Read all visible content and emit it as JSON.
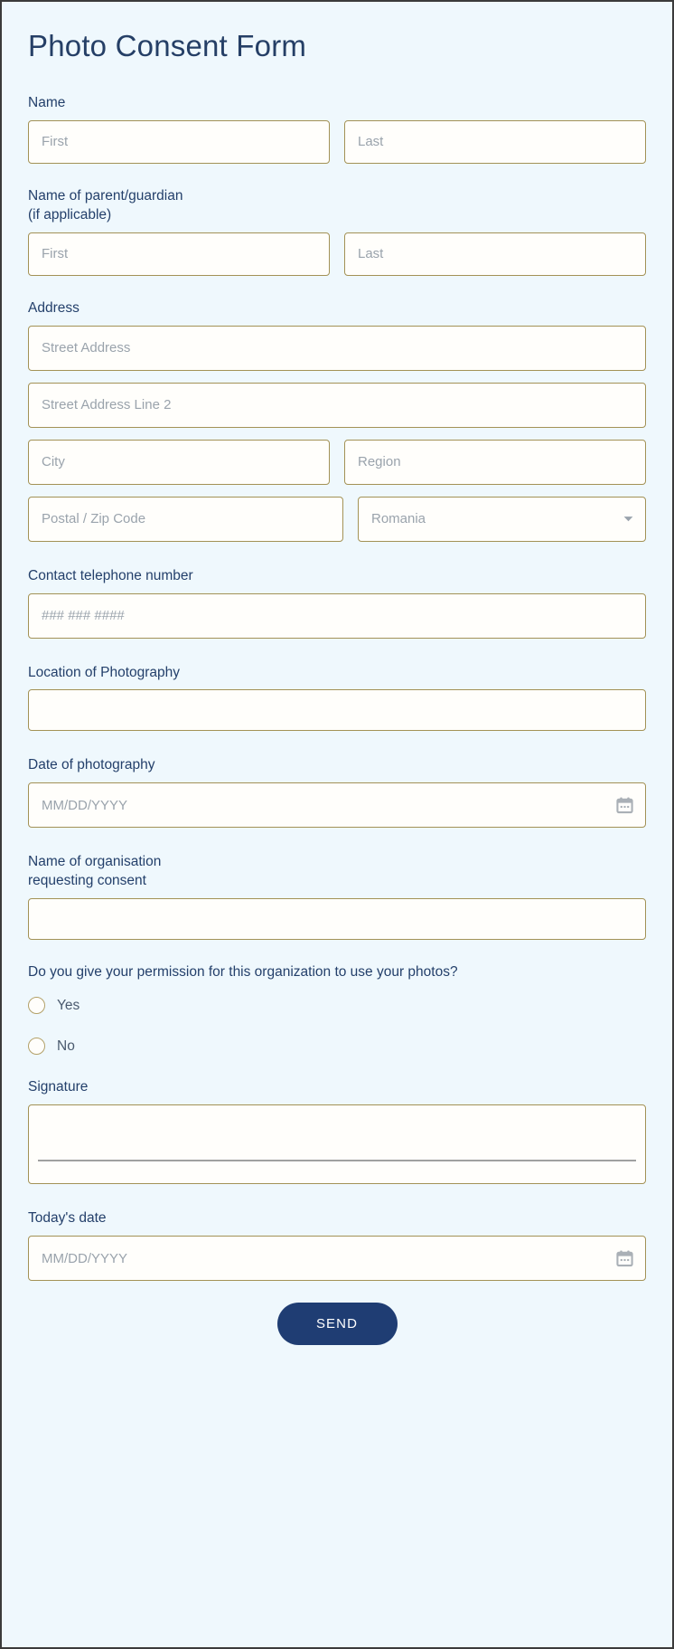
{
  "form": {
    "title": "Photo Consent Form",
    "accent_color": "#1f3d73",
    "label_color": "#24406b",
    "background_color": "#eff8fd",
    "input_border_color": "#a39256",
    "input_background_color": "#fffefb"
  },
  "name": {
    "label": "Name",
    "first_placeholder": "First",
    "last_placeholder": "Last",
    "first_value": "",
    "last_value": ""
  },
  "guardian": {
    "label": "Name of parent/guardian\n(if applicable)",
    "first_placeholder": "First",
    "last_placeholder": "Last",
    "first_value": "",
    "last_value": ""
  },
  "address": {
    "label": "Address",
    "street_placeholder": "Street Address",
    "street2_placeholder": "Street Address Line 2",
    "city_placeholder": "City",
    "region_placeholder": "Region",
    "postal_placeholder": "Postal / Zip Code",
    "country_selected": "Romania",
    "street_value": "",
    "street2_value": "",
    "city_value": "",
    "region_value": "",
    "postal_value": ""
  },
  "phone": {
    "label": "Contact telephone number",
    "placeholder": "### ### ####",
    "value": ""
  },
  "location": {
    "label": "Location of Photography",
    "value": ""
  },
  "date_of_photography": {
    "label": "Date of photography",
    "placeholder": "MM/DD/YYYY",
    "value": "",
    "icon": "calendar-icon"
  },
  "organisation": {
    "label": "Name of organisation\nrequesting consent",
    "value": ""
  },
  "permission": {
    "question": "Do you give your permission for this organization to use your photos?",
    "options": [
      {
        "label": "Yes",
        "selected": false
      },
      {
        "label": "No",
        "selected": false
      }
    ]
  },
  "signature": {
    "label": "Signature",
    "value": ""
  },
  "todays_date": {
    "label": "Today's date",
    "placeholder": "MM/DD/YYYY",
    "value": "",
    "icon": "calendar-icon"
  },
  "submit": {
    "label": "SEND"
  }
}
